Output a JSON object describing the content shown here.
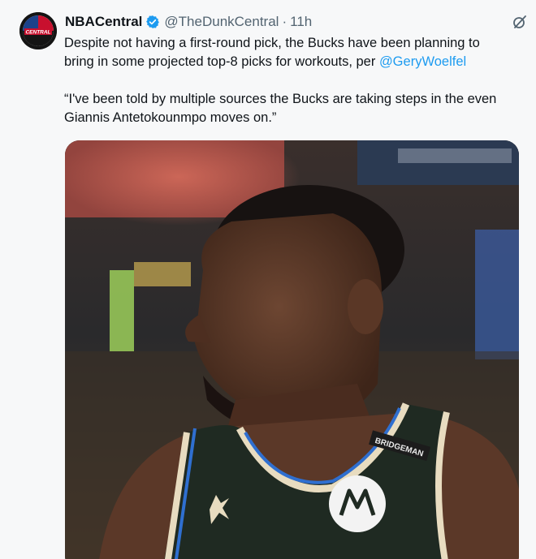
{
  "tweet": {
    "display_name": "NBACentral",
    "handle": "@TheDunkCentral",
    "separator": "·",
    "time": "11h",
    "avatar_text": "CENTRAL",
    "line1": "Despite not having a first-round pick, the Bucks have been planning to",
    "line2_prefix": "bring in some projected top-8 picks for workouts, per ",
    "mention": "@GeryWoelfel",
    "quote_line1": "“I've been told by multiple sources the Bucks are taking steps in the even",
    "quote_line2": "Giannis Antetokounmpo moves on.”"
  },
  "media": {
    "jersey_patch_text": "BRIDGEMAN"
  },
  "colors": {
    "accent": "#1d9bf0",
    "secondary_text": "#536471"
  },
  "icons": {
    "verified": "verified-badge-icon",
    "more": "grok-icon"
  }
}
